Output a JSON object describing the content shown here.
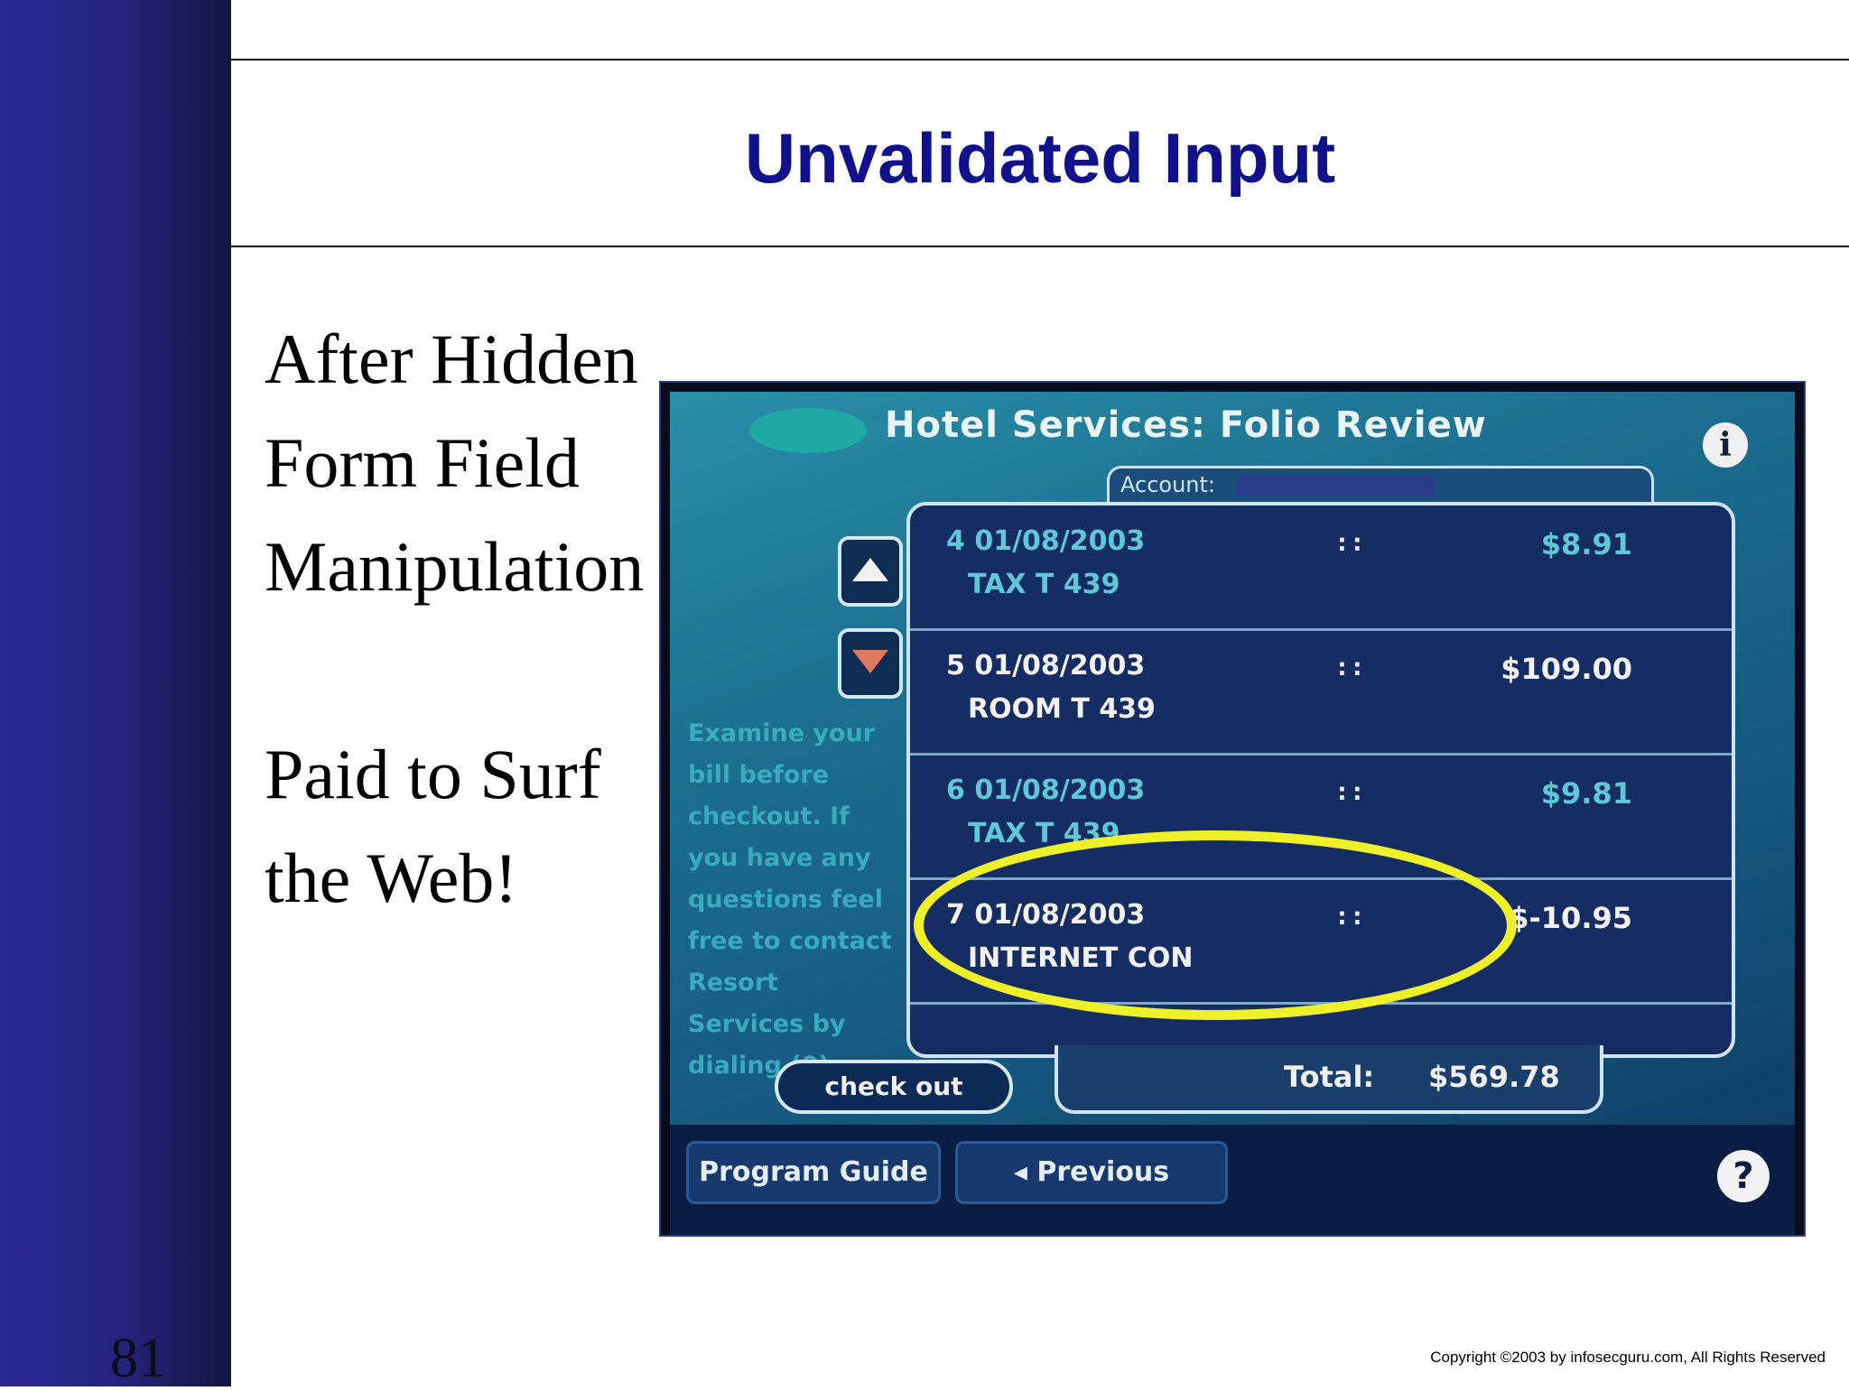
{
  "slide": {
    "title": "Unvalidated Input",
    "number": "81",
    "bullets": [
      "After Hidden",
      "Form Field",
      "Manipulation",
      "Paid to Surf",
      "the Web!"
    ],
    "copyright": "Copyright  ©2003 by infosecguru.com, All Rights Reserved"
  },
  "screen": {
    "title": "Hotel Services: Folio Review",
    "account_label": "Account:",
    "side_message": "Examine your bill before checkout. If you have any questions feel free to contact Resort Services by dialing (0)",
    "rows": [
      {
        "index_date": "4 01/08/2003",
        "desc": "TAX  T  439",
        "sep": "::",
        "amount": "$8.91",
        "style": "teal"
      },
      {
        "index_date": "5 01/08/2003",
        "desc": "ROOM T  439",
        "sep": "::",
        "amount": "$109.00",
        "style": "white"
      },
      {
        "index_date": "6 01/08/2003",
        "desc": "TAX  T  439",
        "sep": "::",
        "amount": "$9.81",
        "style": "teal"
      },
      {
        "index_date": "7 01/08/2003",
        "desc": "INTERNET CON",
        "sep": "::",
        "amount": "$-10.95",
        "style": "white"
      }
    ],
    "checkout_label": "check out",
    "total_label": "Total:",
    "total_value": "$569.78",
    "nav": {
      "program_guide": "Program Guide",
      "previous": "◂ Previous"
    },
    "icons": {
      "info": "info-icon",
      "help": "help-icon",
      "up": "arrow-up-icon",
      "down": "arrow-down-icon"
    },
    "colors": {
      "highlight": "#eef02a",
      "title_blue": "#11118c"
    }
  }
}
